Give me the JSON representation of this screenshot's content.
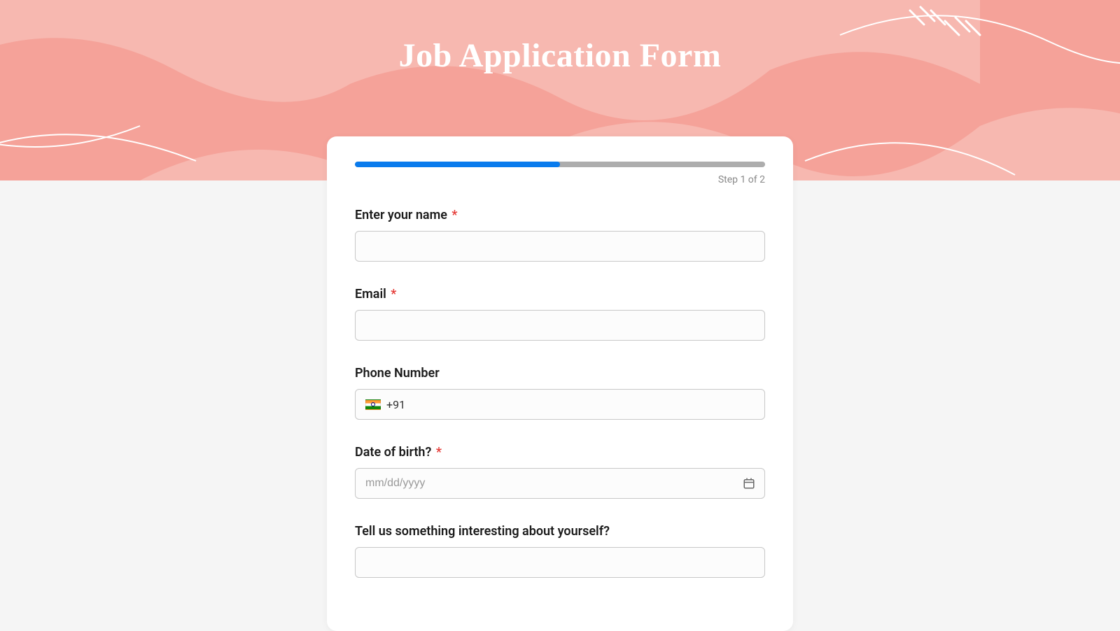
{
  "header": {
    "title": "Job Application Form"
  },
  "progress": {
    "percent": 50,
    "step_text": "Step 1 of 2"
  },
  "form": {
    "name": {
      "label": "Enter your name",
      "required": true,
      "value": ""
    },
    "email": {
      "label": "Email",
      "required": true,
      "value": ""
    },
    "phone": {
      "label": "Phone Number",
      "required": false,
      "country_code": "+91",
      "country": "India",
      "value": ""
    },
    "dob": {
      "label": "Date of birth?",
      "required": true,
      "placeholder": "mm/dd/yyyy",
      "value": ""
    },
    "about": {
      "label": "Tell us something interesting about yourself?",
      "required": false,
      "value": ""
    }
  }
}
